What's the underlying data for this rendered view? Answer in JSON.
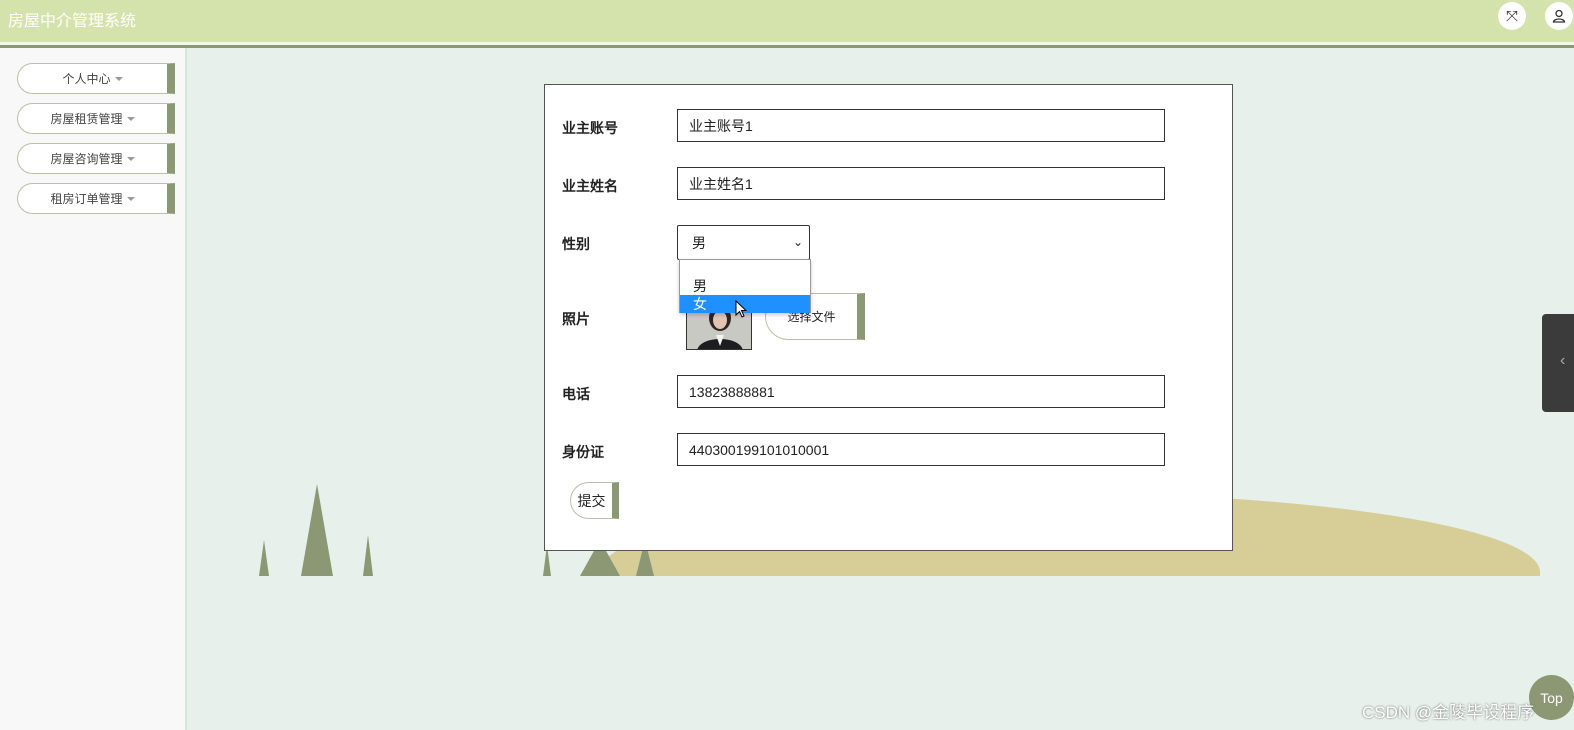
{
  "header": {
    "title": "房屋中介管理系统",
    "fullscreen_icon": "fullscreen-icon",
    "user_icon": "user-icon"
  },
  "sidebar": {
    "items": [
      {
        "label": "个人中心"
      },
      {
        "label": "房屋租赁管理"
      },
      {
        "label": "房屋咨询管理"
      },
      {
        "label": "租房订单管理"
      }
    ]
  },
  "form": {
    "account": {
      "label": "业主账号",
      "value": "业主账号1"
    },
    "name": {
      "label": "业主姓名",
      "value": "业主姓名1"
    },
    "gender": {
      "label": "性别",
      "value": "男",
      "options": [
        "男",
        "女"
      ],
      "highlighted": "女"
    },
    "photo": {
      "label": "照片",
      "button": "选择文件"
    },
    "phone": {
      "label": "电话",
      "value": "13823888881"
    },
    "id_card": {
      "label": "身份证",
      "value": "440300199101010001"
    },
    "submit_label": "提交"
  },
  "misc": {
    "top_button": "Top",
    "watermark": "CSDN @金陵毕设程序"
  },
  "colors": {
    "header_bg": "#d4e3ab",
    "accent": "#8c9873",
    "page_bg": "#e7f0ea",
    "hill": "#d7cd97",
    "selected_option": "#1e90ff"
  }
}
